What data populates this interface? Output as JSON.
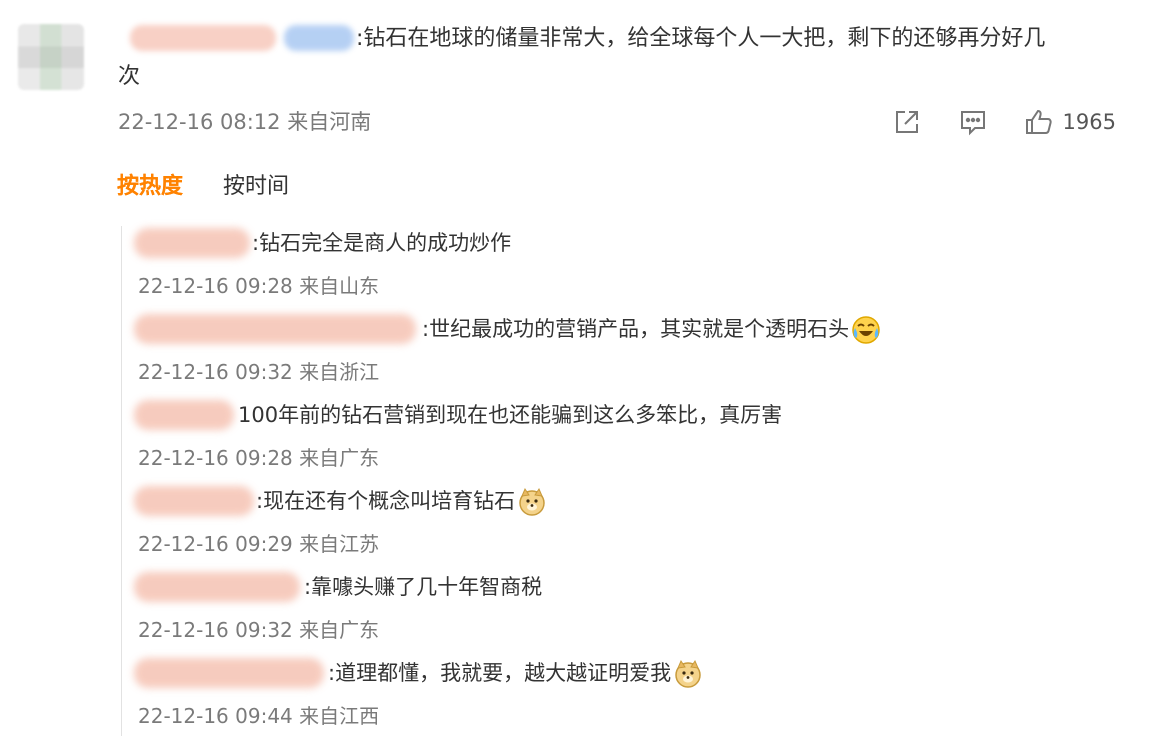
{
  "main": {
    "text": ":钻石在地球的储量非常大，给全球每个人一大把，剩下的还够再分好几",
    "text_cont": "次",
    "time": "22-12-16 08:12",
    "location": "来自河南",
    "like_count": "1965"
  },
  "tabs": {
    "hot": "按热度",
    "time": "按时间"
  },
  "replies": [
    {
      "text": ":钻石完全是商人的成功炒作",
      "time": "22-12-16 09:28",
      "location": "来自山东",
      "emoji": ""
    },
    {
      "text": ":世纪最成功的营销产品，其实就是个透明石头",
      "time": "22-12-16 09:32",
      "location": "来自浙江",
      "emoji": "laugh-cry-emoji"
    },
    {
      "text": "100年前的钻石营销到现在也还能骗到这么多笨比，真厉害",
      "time": "22-12-16 09:28",
      "location": "来自广东",
      "emoji": ""
    },
    {
      "text": ":现在还有个概念叫培育钻石",
      "time": "22-12-16 09:29",
      "location": "来自江苏",
      "emoji": "doge-emoji"
    },
    {
      "text": ":靠噱头赚了几十年智商税",
      "time": "22-12-16 09:32",
      "location": "来自广东",
      "emoji": ""
    },
    {
      "text": ":道理都懂，我就要，越大越证明爱我",
      "time": "22-12-16 09:44",
      "location": "来自江西",
      "emoji": "doge-emoji"
    }
  ],
  "colors": {
    "accent": "#ff8200",
    "meta": "#7a7a7a",
    "text": "#333333"
  },
  "icons": [
    "share-icon",
    "comment-icon",
    "like-icon"
  ]
}
